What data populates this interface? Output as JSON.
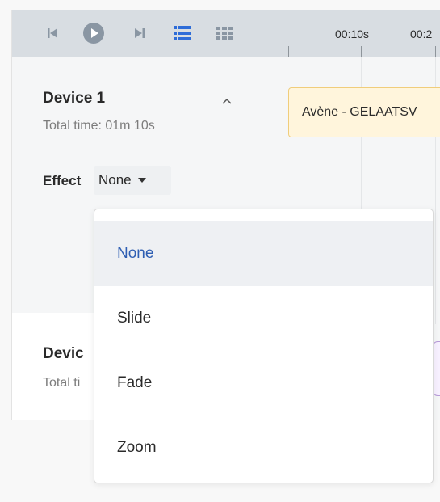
{
  "toolbar": {
    "icons": [
      "skip-back-icon",
      "play-icon",
      "skip-forward-icon",
      "list-view-icon",
      "grid-view-icon"
    ],
    "active_icon_color": "#2e6cd8",
    "icon_color": "#8a96a3"
  },
  "timeline": {
    "ticks": [
      "00:10s",
      "00:2"
    ],
    "clip_label": "Avène - GELAATSV"
  },
  "device1": {
    "name": "Device 1",
    "total_time": "Total time: 01m 10s",
    "effect_label": "Effect",
    "effect_value": "None"
  },
  "device2": {
    "name": "Devic",
    "total_time": "Total ti"
  },
  "dropdown": {
    "options": [
      "None",
      "Slide",
      "Fade",
      "Zoom"
    ],
    "selected": "None",
    "selected_color": "#2f5fb3"
  }
}
